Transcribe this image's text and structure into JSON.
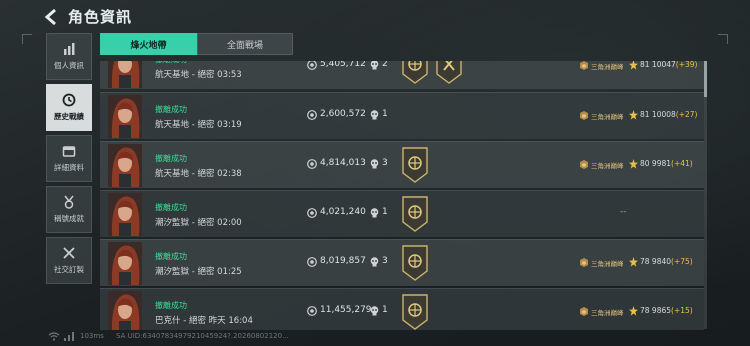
{
  "header": {
    "title": "角色資訊"
  },
  "sidebar": {
    "items": [
      {
        "label": "個人資訊",
        "icon": "bar-chart-icon"
      },
      {
        "label": "歷史戰績",
        "icon": "clock-icon",
        "active": true
      },
      {
        "label": "詳細資料",
        "icon": "folder-icon"
      },
      {
        "label": "稱號成就",
        "icon": "medal-icon"
      },
      {
        "label": "社交訂製",
        "icon": "tools-icon"
      }
    ]
  },
  "tabs": [
    {
      "label": "烽火地帶",
      "active": true
    },
    {
      "label": "全面戰場",
      "active": false
    }
  ],
  "records": [
    {
      "status": "撤離成功",
      "map": "航天基地 - 絕密 03:53",
      "money": "5,405,712",
      "kills": "2",
      "badges": 2,
      "rank": "三角洲巔峰",
      "score": "81 10047",
      "delta": "(+39)"
    },
    {
      "status": "撤離成功",
      "map": "航天基地 - 絕密 03:19",
      "money": "2,600,572",
      "kills": "1",
      "badges": 0,
      "rank": "三角洲巔峰",
      "score": "81 10008",
      "delta": "(+27)"
    },
    {
      "status": "撤離成功",
      "map": "航天基地 - 絕密 02:38",
      "money": "4,814,013",
      "kills": "3",
      "badges": 1,
      "rank": "三角洲巔峰",
      "score": "80 9981",
      "delta": "(+41)"
    },
    {
      "status": "撤離成功",
      "map": "潮汐監獄 - 絕密 02:00",
      "money": "4,021,240",
      "kills": "1",
      "badges": 1,
      "rank": "",
      "score": "--",
      "delta": ""
    },
    {
      "status": "撤離成功",
      "map": "潮汐監獄 - 絕密 01:25",
      "money": "8,019,857",
      "kills": "3",
      "badges": 1,
      "rank": "三角洲巔峰",
      "score": "78 9840",
      "delta": "(+75)"
    },
    {
      "status": "撤離成功",
      "map": "巴克什 - 絕密 昨天 16:04",
      "money": "11,455,279",
      "kills": "1",
      "badges": 1,
      "rank": "三角洲巔峰",
      "score": "78 9865",
      "delta": "(+15)"
    }
  ],
  "footer": {
    "ping": "103ms",
    "uid": "SA UID:6340783497921045924?.20260802120..."
  },
  "colors": {
    "accent": "#37d0ab",
    "success": "#3ddc97",
    "gold": "#e7c24a"
  }
}
